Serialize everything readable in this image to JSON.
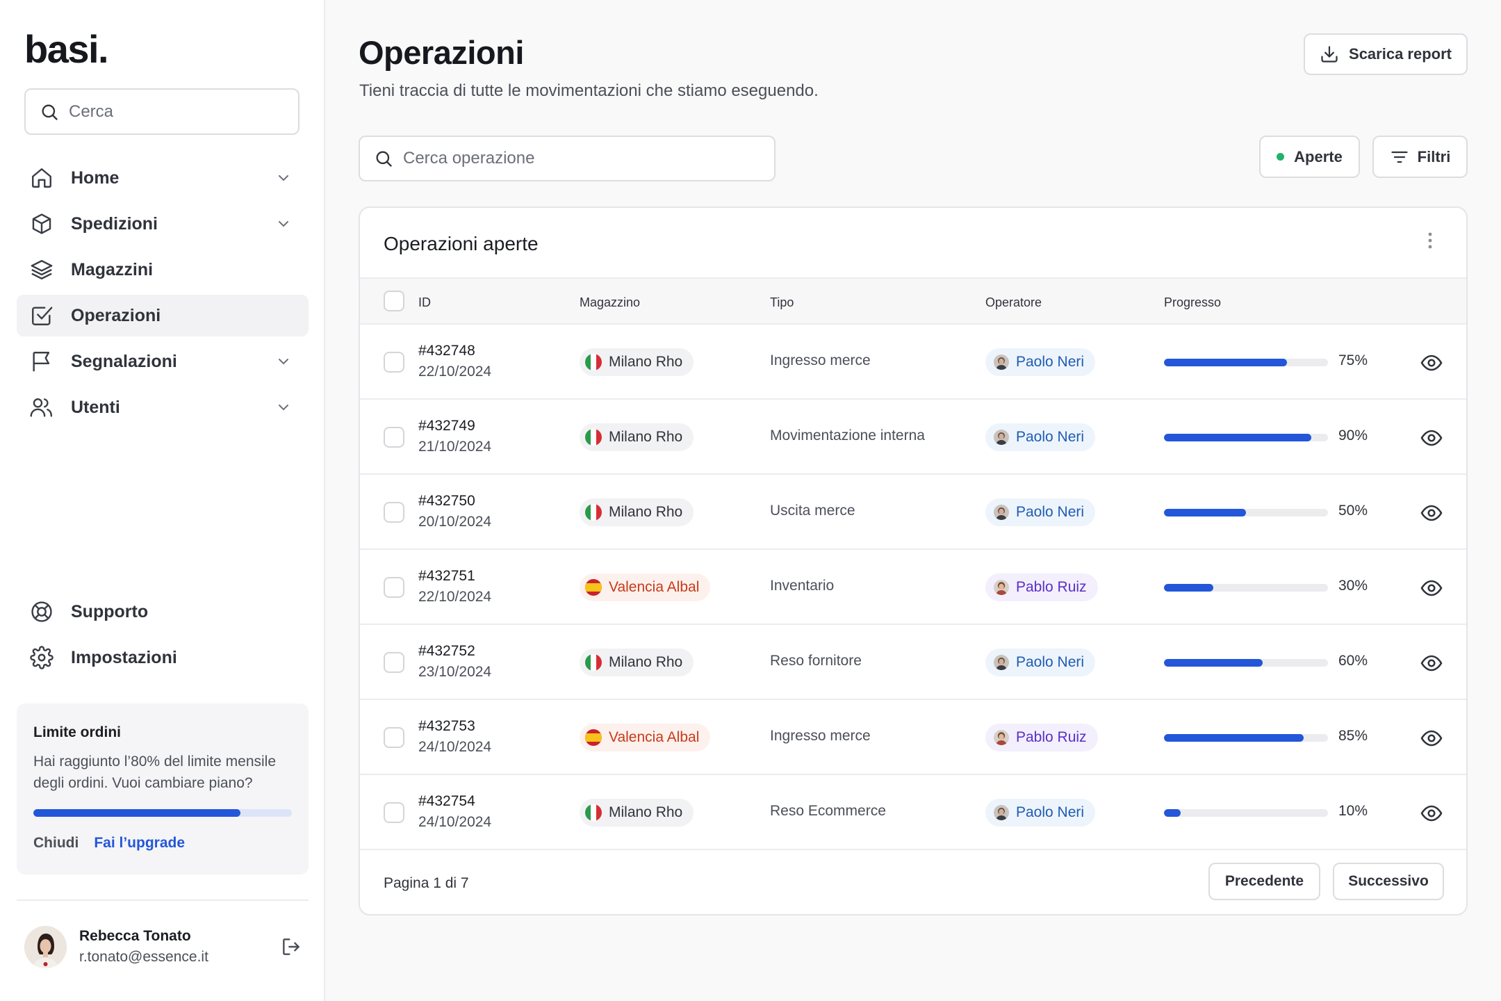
{
  "brand": {
    "logo": "basi."
  },
  "sidebar": {
    "search_placeholder": "Cerca",
    "items": [
      {
        "label": "Home",
        "icon": "home-icon",
        "has_chevron": true
      },
      {
        "label": "Spedizioni",
        "icon": "box-icon",
        "has_chevron": true
      },
      {
        "label": "Magazzini",
        "icon": "layers-icon",
        "has_chevron": false
      },
      {
        "label": "Operazioni",
        "icon": "check-square-icon",
        "has_chevron": false,
        "active": true
      },
      {
        "label": "Segnalazioni",
        "icon": "flag-icon",
        "has_chevron": true
      },
      {
        "label": "Utenti",
        "icon": "users-icon",
        "has_chevron": true
      }
    ],
    "bottom_items": [
      {
        "label": "Supporto",
        "icon": "lifebuoy-icon"
      },
      {
        "label": "Impostazioni",
        "icon": "gear-icon"
      }
    ],
    "upgrade": {
      "title": "Limite ordini",
      "description": "Hai raggiunto l’80% del limite mensile degli ordini. Vuoi cambiare piano?",
      "progress": 0.8,
      "close_label": "Chiudi",
      "upgrade_label": "Fai l’upgrade"
    },
    "user": {
      "name": "Rebecca Tonato",
      "email": "r.tonato@essence.it"
    }
  },
  "header": {
    "title": "Operazioni",
    "subtitle": "Tieni traccia di tutte le movimentazioni che stiamo eseguendo.",
    "report_button": "Scarica report"
  },
  "toolbar": {
    "search_placeholder": "Cerca operazione",
    "status_filter": "Aperte",
    "filters_label": "Filtri"
  },
  "table": {
    "title": "Operazioni aperte",
    "columns": [
      "ID",
      "Magazzino",
      "Tipo",
      "Operatore",
      "Progresso"
    ],
    "rows": [
      {
        "id": "#432748",
        "date": "22/10/2024",
        "warehouse": "Milano Rho",
        "country": "it",
        "type": "Ingresso merce",
        "operator": "Paolo Neri",
        "progress": 75,
        "progress_label": "75%"
      },
      {
        "id": "#432749",
        "date": "21/10/2024",
        "warehouse": "Milano Rho",
        "country": "it",
        "type": "Movimentazione interna",
        "operator": "Paolo Neri",
        "progress": 90,
        "progress_label": "90%"
      },
      {
        "id": "#432750",
        "date": "20/10/2024",
        "warehouse": "Milano Rho",
        "country": "it",
        "type": "Uscita merce",
        "operator": "Paolo Neri",
        "progress": 50,
        "progress_label": "50%"
      },
      {
        "id": "#432751",
        "date": "22/10/2024",
        "warehouse": "Valencia Albal",
        "country": "es",
        "type": "Inventario",
        "operator": "Pablo Ruiz",
        "progress": 30,
        "progress_label": "30%"
      },
      {
        "id": "#432752",
        "date": "23/10/2024",
        "warehouse": "Milano Rho",
        "country": "it",
        "type": "Reso fornitore",
        "operator": "Paolo Neri",
        "progress": 60,
        "progress_label": "60%"
      },
      {
        "id": "#432753",
        "date": "24/10/2024",
        "warehouse": "Valencia Albal",
        "country": "es",
        "type": "Ingresso merce",
        "operator": "Pablo Ruiz",
        "progress": 85,
        "progress_label": "85%"
      },
      {
        "id": "#432754",
        "date": "24/10/2024",
        "warehouse": "Milano Rho",
        "country": "it",
        "type": "Reso Ecommerce",
        "operator": "Paolo Neri",
        "progress": 10,
        "progress_label": "10%"
      }
    ],
    "pagination": {
      "label": "Pagina 1 di 7",
      "prev": "Precedente",
      "next": "Successivo"
    }
  },
  "colors": {
    "accent": "#2356d9",
    "status_open": "#1fb36b",
    "operator_paolo_text": "#1f5cb4",
    "operator_pablo_text": "#5a2ec9",
    "warehouse_es_text": "#c83a18"
  }
}
